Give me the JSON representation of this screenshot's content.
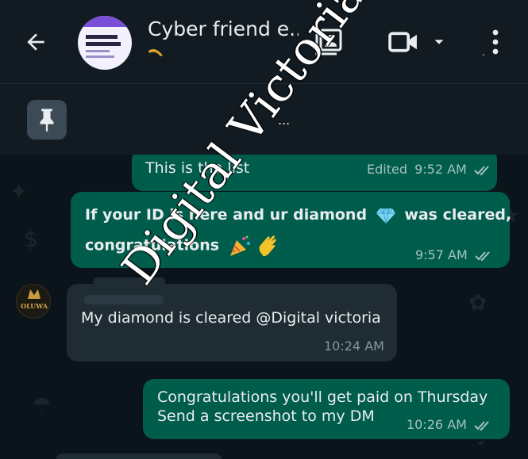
{
  "header": {
    "title": "Cyber friend e...",
    "subtitle_dots": "⠀⠀⠀⠀⠀⠀⠀⠀⠀⠀⠀⠀⠀⠀⠀⠀⠀⠀⠀⠀⠀⠀⠀.",
    "icons": [
      "back-arrow-icon",
      "contact-card-icon",
      "video-call-icon",
      "chevron-down-icon",
      "more-vertical-icon"
    ]
  },
  "pinned": {
    "icon": "pin-icon",
    "text": "..."
  },
  "messages": [
    {
      "direction": "out",
      "text": "This is the list",
      "edited_label": "Edited",
      "time": "9:52 AM",
      "status": "double-check-icon"
    },
    {
      "direction": "out",
      "line1": "If your ID is here and ur diamond",
      "line1_end": "was cleared,",
      "line2": "congratulations",
      "time": "9:57 AM",
      "status": "double-check-icon"
    },
    {
      "direction": "in",
      "text": "My diamond is cleared @Digital victoria",
      "time": "10:24 AM"
    },
    {
      "direction": "out",
      "line1": "Congratulations you'll get paid on Thursday",
      "line2": "Send a screenshot to my DM",
      "time": "10:26 AM",
      "status": "double-check-icon"
    }
  ],
  "avatar_in_text": "OLUWA",
  "watermark": "Digital Victoria",
  "colors": {
    "header_bg": "#111b21",
    "chat_bg": "#0b141a",
    "outgoing_bubble": "#005c4b",
    "incoming_bubble": "#202c33"
  }
}
